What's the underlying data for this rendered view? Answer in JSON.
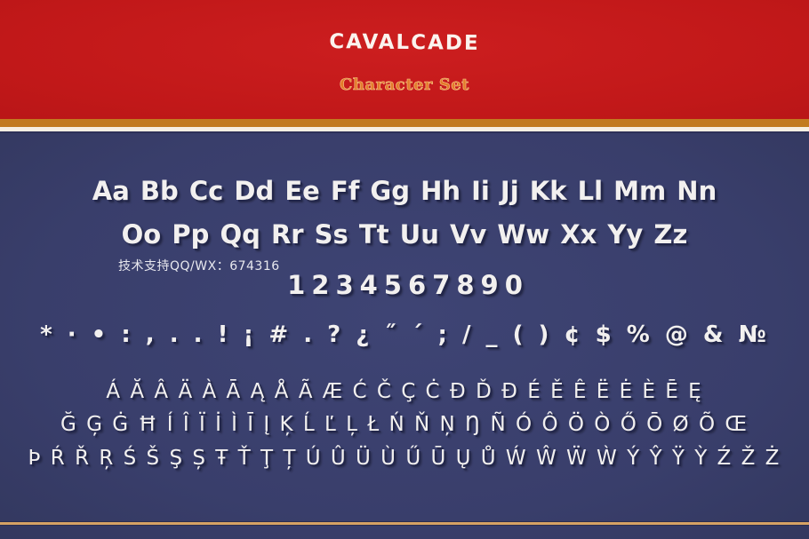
{
  "header": {
    "title": "CAVALCADE",
    "subtitle": "Character Set"
  },
  "glyphs": {
    "alphabet_row_1": "Aa Bb Cc Dd Ee Ff Gg Hh Ii Jj Kk Ll Mm Nn",
    "alphabet_row_2": "Oo Pp Qq Rr Ss Tt Uu Vv Ww Xx Yy Zz",
    "digits": "1234567890",
    "punctuation": "* · • : , . . ! ¡ # . ? ¿ ˝ ´ ; / _ ( ) ¢ $ % @ & №",
    "accented_row_1": "ÁĂÂÄÀĀĄÅÃÆĆČÇĊĐĎĐÉĚÊËĖÈĒĘ",
    "accented_row_2": "ĞĢĠĦÍÎÏİÌĪĮĶĹĽĻŁŃŇŅŊÑÓÔÖÒŐŌØÕŒ",
    "accented_row_3": "ÞŔŘŖŚŠŞȘŦŤŢȚÚÛÜÙŰŪŲŮẂŴẄẀÝŶŸỲŹŽŻ"
  },
  "watermark": {
    "text": "技术支持QQ/WX：674316"
  },
  "colors": {
    "header_red": "#c61a1c",
    "gold_stripe": "#c27a1f",
    "cream_stripe": "#f7efe2",
    "navy_background": "#3a3f6d",
    "glyph_white": "#f2f0ef",
    "subtitle_orange": "#e47a2a",
    "bottom_gold_line": "#d6a264"
  }
}
